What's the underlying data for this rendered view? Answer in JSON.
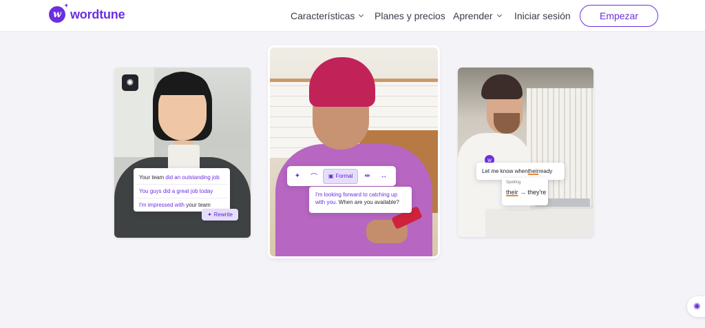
{
  "header": {
    "brand": "wordtune",
    "nav": [
      {
        "label": "Características",
        "has_dropdown": true
      },
      {
        "label": "Planes y precios",
        "has_dropdown": false
      },
      {
        "label": "Aprender",
        "has_dropdown": true
      },
      {
        "label": "Iniciar sesión",
        "has_dropdown": false
      }
    ],
    "cta_label": "Empezar"
  },
  "colors": {
    "brand_purple": "#6b2ee0",
    "accent_light": "#e6ddfb",
    "page_background": "#f4f3f7",
    "spelling_underline": "#e48a3a"
  },
  "card1": {
    "badge_icon": "brain-icon",
    "rewrite_options": [
      {
        "normal_before": "Your team ",
        "highlight": "did an outstanding job",
        "normal_after": ""
      },
      {
        "normal_before": "",
        "highlight": "You guys did a great job today",
        "normal_after": ""
      },
      {
        "normal_before": "",
        "highlight": "I'm impressed with",
        "normal_after": " your team"
      }
    ],
    "rewrite_button": "Rewrite",
    "rewrite_icon": "sparkle-icon"
  },
  "card2": {
    "toolbar": {
      "icons": [
        "sparkle-icon",
        "shoe-icon",
        "shrink-icon",
        "expand-icon"
      ],
      "formal_label": "Formal",
      "formal_icon": "briefcase-icon"
    },
    "suggestion_highlight": "I'm looking forward to catching up with you.",
    "suggestion_rest": " When are you available?"
  },
  "card3": {
    "sentence_before": "Let me know when ",
    "sentence_error": "their",
    "sentence_after": " ready",
    "spelling_title": "Spelling",
    "spelling_from": "their",
    "spelling_arrow": "→",
    "spelling_to": "they're"
  },
  "floating": {
    "brain_icon": "brain-icon"
  }
}
